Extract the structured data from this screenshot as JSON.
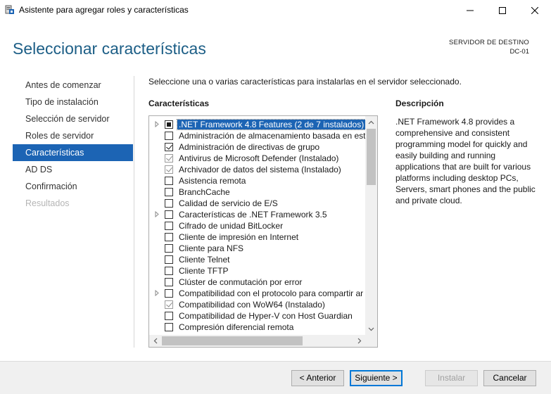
{
  "window": {
    "title": "Asistente para agregar roles y características",
    "icons": {
      "app": "server-manager-icon",
      "minimize": "minimize-icon",
      "maximize": "maximize-icon",
      "close": "close-icon"
    }
  },
  "header": {
    "title": "Seleccionar características",
    "destination_label": "SERVIDOR DE DESTINO",
    "destination_value": "DC-01"
  },
  "nav": {
    "items": [
      {
        "label": "Antes de comenzar",
        "state": "normal"
      },
      {
        "label": "Tipo de instalación",
        "state": "normal"
      },
      {
        "label": "Selección de servidor",
        "state": "normal"
      },
      {
        "label": "Roles de servidor",
        "state": "normal"
      },
      {
        "label": "Características",
        "state": "active"
      },
      {
        "label": "AD DS",
        "state": "normal"
      },
      {
        "label": "Confirmación",
        "state": "normal"
      },
      {
        "label": "Resultados",
        "state": "disabled"
      }
    ]
  },
  "main": {
    "intro": "Seleccione una o varias características para instalarlas en el servidor seleccionado.",
    "features_heading": "Características",
    "description_heading": "Descripción",
    "description_text": ".NET Framework 4.8 provides a comprehensive and consistent programming model for quickly and easily building and running applications that are built for various platforms including desktop PCs, Servers, smart phones and the public and private cloud.",
    "features": [
      {
        "label": ".NET Framework 4.8 Features (2 de 7 instalados)",
        "state": "partial",
        "expandable": true,
        "selected": true
      },
      {
        "label": "Administración de almacenamiento basada en están",
        "state": "unchecked",
        "expandable": false
      },
      {
        "label": "Administración de directivas de grupo",
        "state": "checked",
        "expandable": false
      },
      {
        "label": "Antivirus de Microsoft Defender (Instalado)",
        "state": "checked-dim",
        "expandable": false
      },
      {
        "label": "Archivador de datos del sistema (Instalado)",
        "state": "checked-dim",
        "expandable": false
      },
      {
        "label": "Asistencia remota",
        "state": "unchecked",
        "expandable": false
      },
      {
        "label": "BranchCache",
        "state": "unchecked",
        "expandable": false
      },
      {
        "label": "Calidad de servicio de E/S",
        "state": "unchecked",
        "expandable": false
      },
      {
        "label": "Características de .NET Framework 3.5",
        "state": "unchecked",
        "expandable": true
      },
      {
        "label": "Cifrado de unidad BitLocker",
        "state": "unchecked",
        "expandable": false
      },
      {
        "label": "Cliente de impresión en Internet",
        "state": "unchecked",
        "expandable": false
      },
      {
        "label": "Cliente para NFS",
        "state": "unchecked",
        "expandable": false
      },
      {
        "label": "Cliente Telnet",
        "state": "unchecked",
        "expandable": false
      },
      {
        "label": "Cliente TFTP",
        "state": "unchecked",
        "expandable": false
      },
      {
        "label": "Clúster de conmutación por error",
        "state": "unchecked",
        "expandable": false
      },
      {
        "label": "Compatibilidad con el protocolo para compartir ar",
        "state": "unchecked",
        "expandable": true
      },
      {
        "label": "Compatibilidad con WoW64 (Instalado)",
        "state": "checked-dim",
        "expandable": false
      },
      {
        "label": "Compatibilidad de Hyper-V con Host Guardian",
        "state": "unchecked",
        "expandable": false
      },
      {
        "label": "Compresión diferencial remota",
        "state": "unchecked",
        "expandable": false
      }
    ]
  },
  "footer": {
    "back_label": "< Anterior",
    "next_label": "Siguiente >",
    "install_label": "Instalar",
    "cancel_label": "Cancelar"
  },
  "colors": {
    "accent": "#1c64b4",
    "title": "#1c5e86"
  }
}
